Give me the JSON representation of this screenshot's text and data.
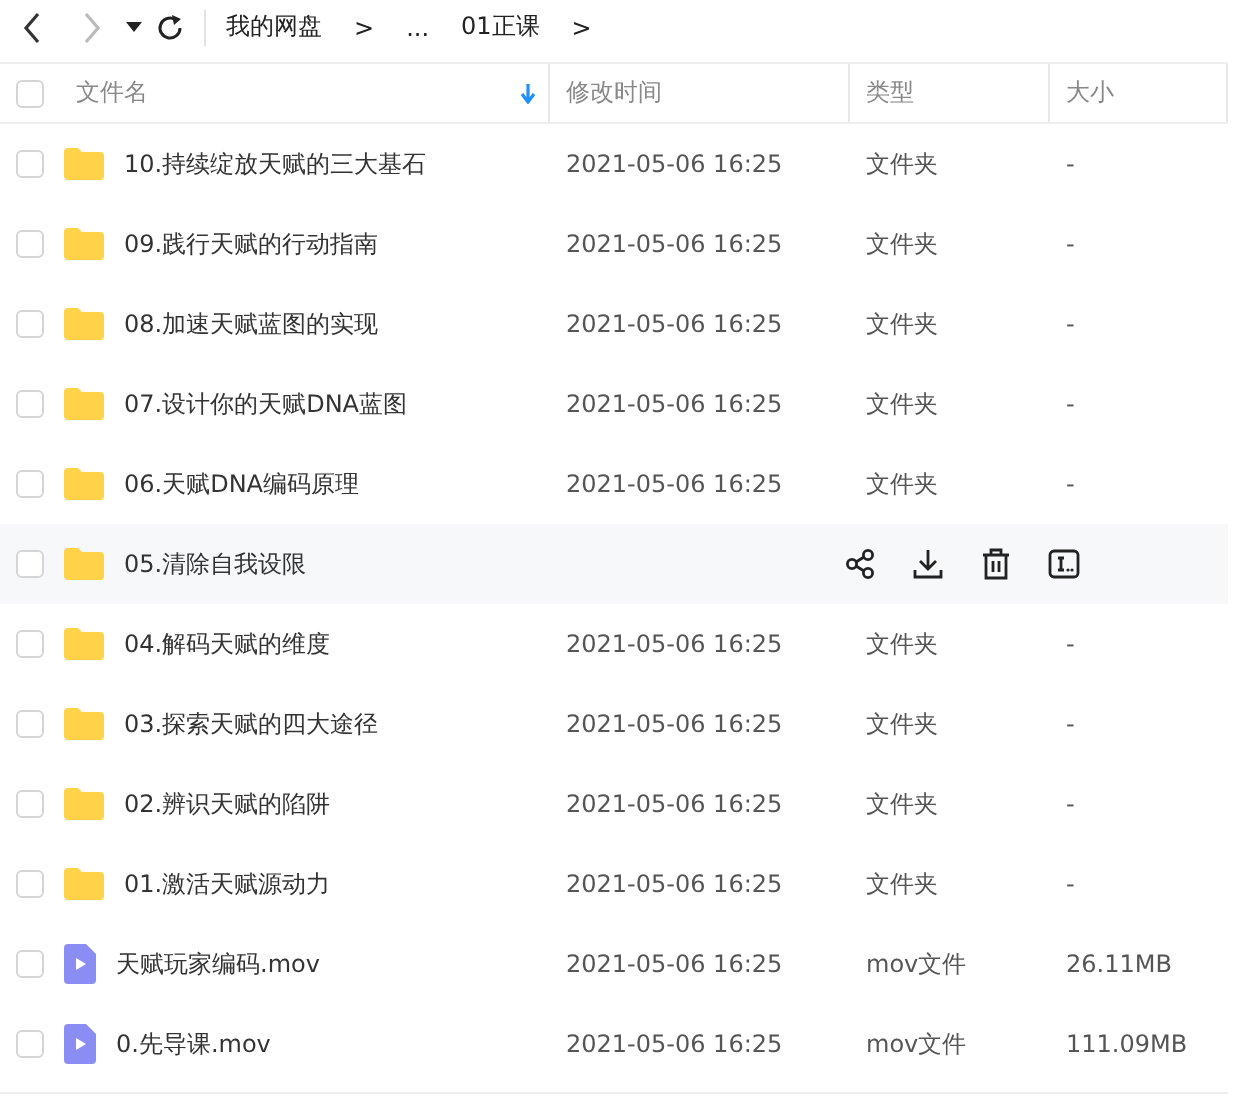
{
  "toolbar": {
    "breadcrumbs": [
      "我的网盘",
      ">",
      "...",
      "01正课",
      ">"
    ]
  },
  "select_all": {
    "checked": false
  },
  "columns": [
    {
      "label": "文件名",
      "sorted": true
    },
    {
      "label": "修改时间",
      "sorted": false
    },
    {
      "label": "类型",
      "sorted": false
    },
    {
      "label": "大小",
      "sorted": false
    }
  ],
  "rows": [
    {
      "kind": "folder",
      "name": "10.持续绽放天赋的三大基石",
      "modified": "2021-05-06 16:25",
      "type": "文件夹",
      "size": "-",
      "hovered": false,
      "checked": false
    },
    {
      "kind": "folder",
      "name": "09.践行天赋的行动指南",
      "modified": "2021-05-06 16:25",
      "type": "文件夹",
      "size": "-",
      "hovered": false,
      "checked": false
    },
    {
      "kind": "folder",
      "name": "08.加速天赋蓝图的实现",
      "modified": "2021-05-06 16:25",
      "type": "文件夹",
      "size": "-",
      "hovered": false,
      "checked": false
    },
    {
      "kind": "folder",
      "name": "07.设计你的天赋DNA蓝图",
      "modified": "2021-05-06 16:25",
      "type": "文件夹",
      "size": "-",
      "hovered": false,
      "checked": false
    },
    {
      "kind": "folder",
      "name": "06.天赋DNA编码原理",
      "modified": "2021-05-06 16:25",
      "type": "文件夹",
      "size": "-",
      "hovered": false,
      "checked": false
    },
    {
      "kind": "folder",
      "name": "05.清除自我设限",
      "hovered": true,
      "checked": false
    },
    {
      "kind": "folder",
      "name": "04.解码天赋的维度",
      "modified": "2021-05-06 16:25",
      "type": "文件夹",
      "size": "-",
      "hovered": false,
      "checked": false
    },
    {
      "kind": "folder",
      "name": "03.探索天赋的四大途径",
      "modified": "2021-05-06 16:25",
      "type": "文件夹",
      "size": "-",
      "hovered": false,
      "checked": false
    },
    {
      "kind": "folder",
      "name": "02.辨识天赋的陷阱",
      "modified": "2021-05-06 16:25",
      "type": "文件夹",
      "size": "-",
      "hovered": false,
      "checked": false
    },
    {
      "kind": "folder",
      "name": "01.激活天赋源动力",
      "modified": "2021-05-06 16:25",
      "type": "文件夹",
      "size": "-",
      "hovered": false,
      "checked": false
    },
    {
      "kind": "video",
      "name": "天赋玩家编码.mov",
      "modified": "2021-05-06 16:25",
      "type": "mov文件",
      "size": "26.11MB",
      "hovered": false,
      "checked": false
    },
    {
      "kind": "video",
      "name": "0.先导课.mov",
      "modified": "2021-05-06 16:25",
      "type": "mov文件",
      "size": "111.09MB",
      "hovered": false,
      "checked": false
    }
  ]
}
